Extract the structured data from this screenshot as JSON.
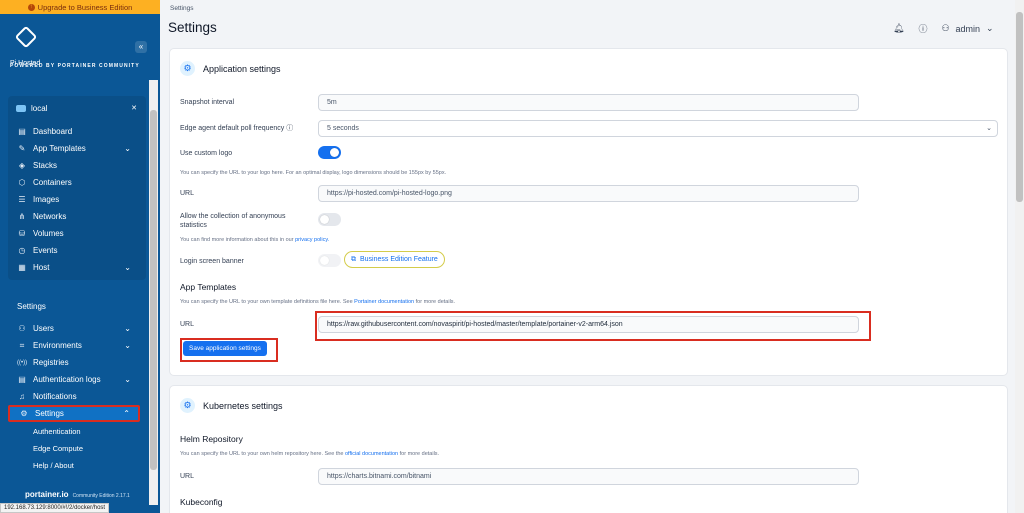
{
  "upgrade": {
    "label": "Upgrade to Business Edition"
  },
  "brand": {
    "logo_text": "Pi Hosted",
    "powered_by": "POWERED BY PORTAINER COMMUNITY",
    "collapse_icon": "«"
  },
  "environment": {
    "name": "local",
    "items": [
      {
        "label": "Dashboard",
        "icon": "▤"
      },
      {
        "label": "App Templates",
        "icon": "✎",
        "chevron": "⌄"
      },
      {
        "label": "Stacks",
        "icon": "◈"
      },
      {
        "label": "Containers",
        "icon": "⬡"
      },
      {
        "label": "Images",
        "icon": "☰"
      },
      {
        "label": "Networks",
        "icon": "⋔"
      },
      {
        "label": "Volumes",
        "icon": "⛁"
      },
      {
        "label": "Events",
        "icon": "◷"
      },
      {
        "label": "Host",
        "icon": "▦",
        "chevron": "⌄"
      }
    ]
  },
  "settings_nav": {
    "title": "Settings",
    "items": [
      {
        "label": "Users",
        "icon": "⚇",
        "chevron": "⌄"
      },
      {
        "label": "Environments",
        "icon": "⌗",
        "chevron": "⌄"
      },
      {
        "label": "Registries",
        "icon": "((•))"
      },
      {
        "label": "Authentication logs",
        "icon": "▤",
        "chevron": "⌄"
      },
      {
        "label": "Notifications",
        "icon": "♫"
      },
      {
        "label": "Settings",
        "icon": "⚙",
        "chevron": "⌃"
      }
    ],
    "sub_items": [
      "Authentication",
      "Edge Compute",
      "Help / About"
    ]
  },
  "footer": {
    "brand": "portainer.io",
    "edition": "Community Edition 2.17.1"
  },
  "status_url": "192.168.73.129:8000/#!/2/docker/host",
  "header": {
    "breadcrumb": "Settings",
    "title": "Settings",
    "user": "admin"
  },
  "app_settings": {
    "title": "Application settings",
    "snapshot_label": "Snapshot interval",
    "snapshot_value": "5m",
    "edge_label": "Edge agent default poll frequency",
    "edge_value": "5 seconds",
    "custom_logo_label": "Use custom logo",
    "custom_logo_help": "You can specify the URL to your logo here. For an optimal display, logo dimensions should be 155px by 55px.",
    "logo_url_label": "URL",
    "logo_url_value": "https://pi-hosted.com/pi-hosted-logo.png",
    "anon_label_1": "Allow the collection of anonymous",
    "anon_label_2": "statistics",
    "anon_help": "You can find more information about this in our",
    "privacy_link": "privacy policy.",
    "banner_label": "Login screen banner",
    "be_feature": "Business Edition Feature",
    "templates_title": "App Templates",
    "templates_help": "You can specify the URL to your own template definitions file here. See",
    "templates_link": "Portainer documentation",
    "templates_help_end": "for more details.",
    "templates_url_label": "URL",
    "templates_url_value": "https://raw.githubusercontent.com/novaspirit/pi-hosted/master/template/portainer-v2-arm64.json",
    "save_label": "Save application settings"
  },
  "k8s_settings": {
    "title": "Kubernetes settings",
    "helm_title": "Helm Repository",
    "helm_help": "You can specify the URL to your own helm repository here. See the",
    "helm_link": "official documentation",
    "helm_help_end": "for more details.",
    "url_label": "URL",
    "url_value": "https://charts.bitnami.com/bitnami",
    "kubeconfig_title": "Kubeconfig"
  },
  "toggles": {
    "custom_logo": true,
    "anonymous_stats": false,
    "login_banner": false
  },
  "colors": {
    "sidebar": "#0b5796",
    "accent": "#1570ef",
    "highlight": "#d92d20",
    "upgrade": "#fdb022"
  }
}
